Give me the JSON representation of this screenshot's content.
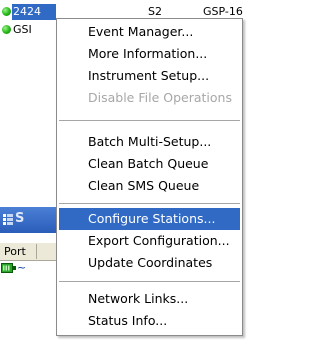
{
  "station_list": {
    "row1": {
      "id": "2424",
      "col2": "S2",
      "col3": "GSP-16"
    },
    "row2": {
      "label": "GSI"
    }
  },
  "left_panel": {
    "title_fragment": "S",
    "port_header": "Port"
  },
  "context_menu": {
    "items": [
      {
        "label": "Event Manager...",
        "state": "enabled"
      },
      {
        "label": "More Information...",
        "state": "enabled"
      },
      {
        "label": "Instrument Setup...",
        "state": "enabled"
      },
      {
        "label": "Disable File Operations",
        "state": "disabled"
      },
      {
        "label": "Batch Multi-Setup...",
        "state": "enabled"
      },
      {
        "label": "Clean Batch Queue",
        "state": "enabled"
      },
      {
        "label": "Clean SMS Queue",
        "state": "enabled"
      },
      {
        "label": "Configure Stations...",
        "state": "highlighted"
      },
      {
        "label": "Export Configuration...",
        "state": "enabled"
      },
      {
        "label": "Update Coordinates",
        "state": "enabled"
      },
      {
        "label": "Network Links...",
        "state": "enabled"
      },
      {
        "label": "Status Info...",
        "state": "enabled"
      }
    ]
  },
  "colors": {
    "selection": "#316ac5",
    "status_online": "#22b614",
    "disabled_text": "#a7a6aa"
  },
  "icons": [
    "status-online-icon",
    "grid-icon",
    "connection-icon"
  ]
}
